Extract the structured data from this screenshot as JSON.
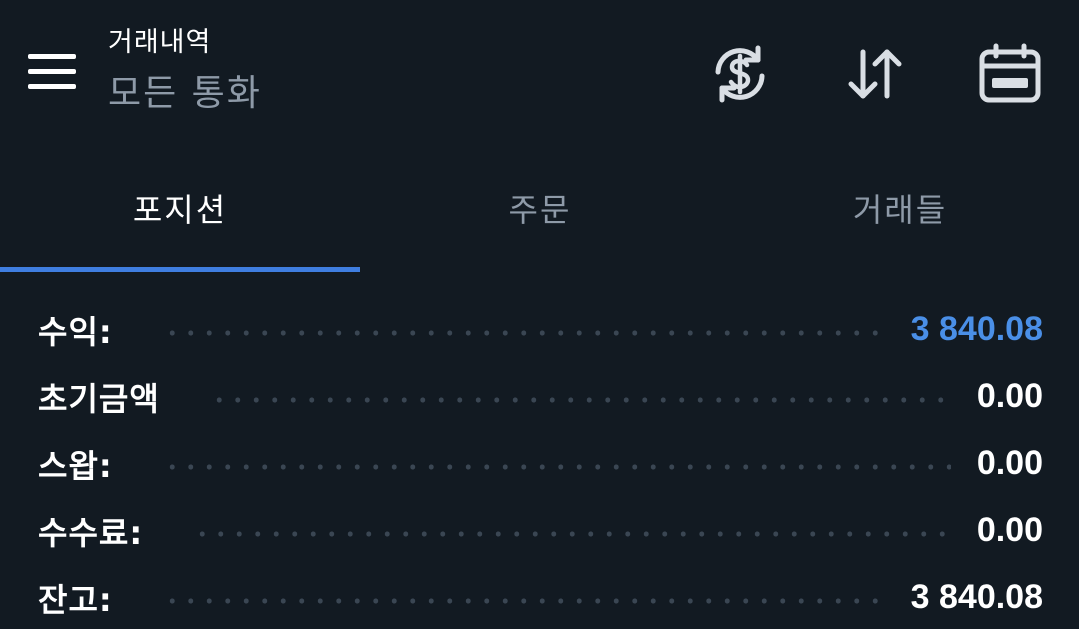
{
  "header": {
    "title": "거래내역",
    "subtitle": "모든 통화",
    "icons": {
      "menu": "hamburger-menu-icon",
      "currency": "currency-exchange-icon",
      "sort": "sort-arrows-icon",
      "calendar": "calendar-icon"
    }
  },
  "tabs": [
    {
      "label": "포지션",
      "active": true
    },
    {
      "label": "주문",
      "active": false
    },
    {
      "label": "거래들",
      "active": false
    }
  ],
  "summary": [
    {
      "label": "수익:",
      "value": "3 840.08",
      "highlight": true
    },
    {
      "label": "초기금액",
      "value": "0.00",
      "highlight": false
    },
    {
      "label": "스왑:",
      "value": "0.00",
      "highlight": false
    },
    {
      "label": "수수료:",
      "value": "0.00",
      "highlight": false
    },
    {
      "label": "잔고:",
      "value": "3 840.08",
      "highlight": false
    }
  ],
  "colors": {
    "background": "#121a22",
    "accent": "#3f7ee0",
    "profit": "#4a8fe7",
    "muted_text": "#8e9aa8"
  }
}
